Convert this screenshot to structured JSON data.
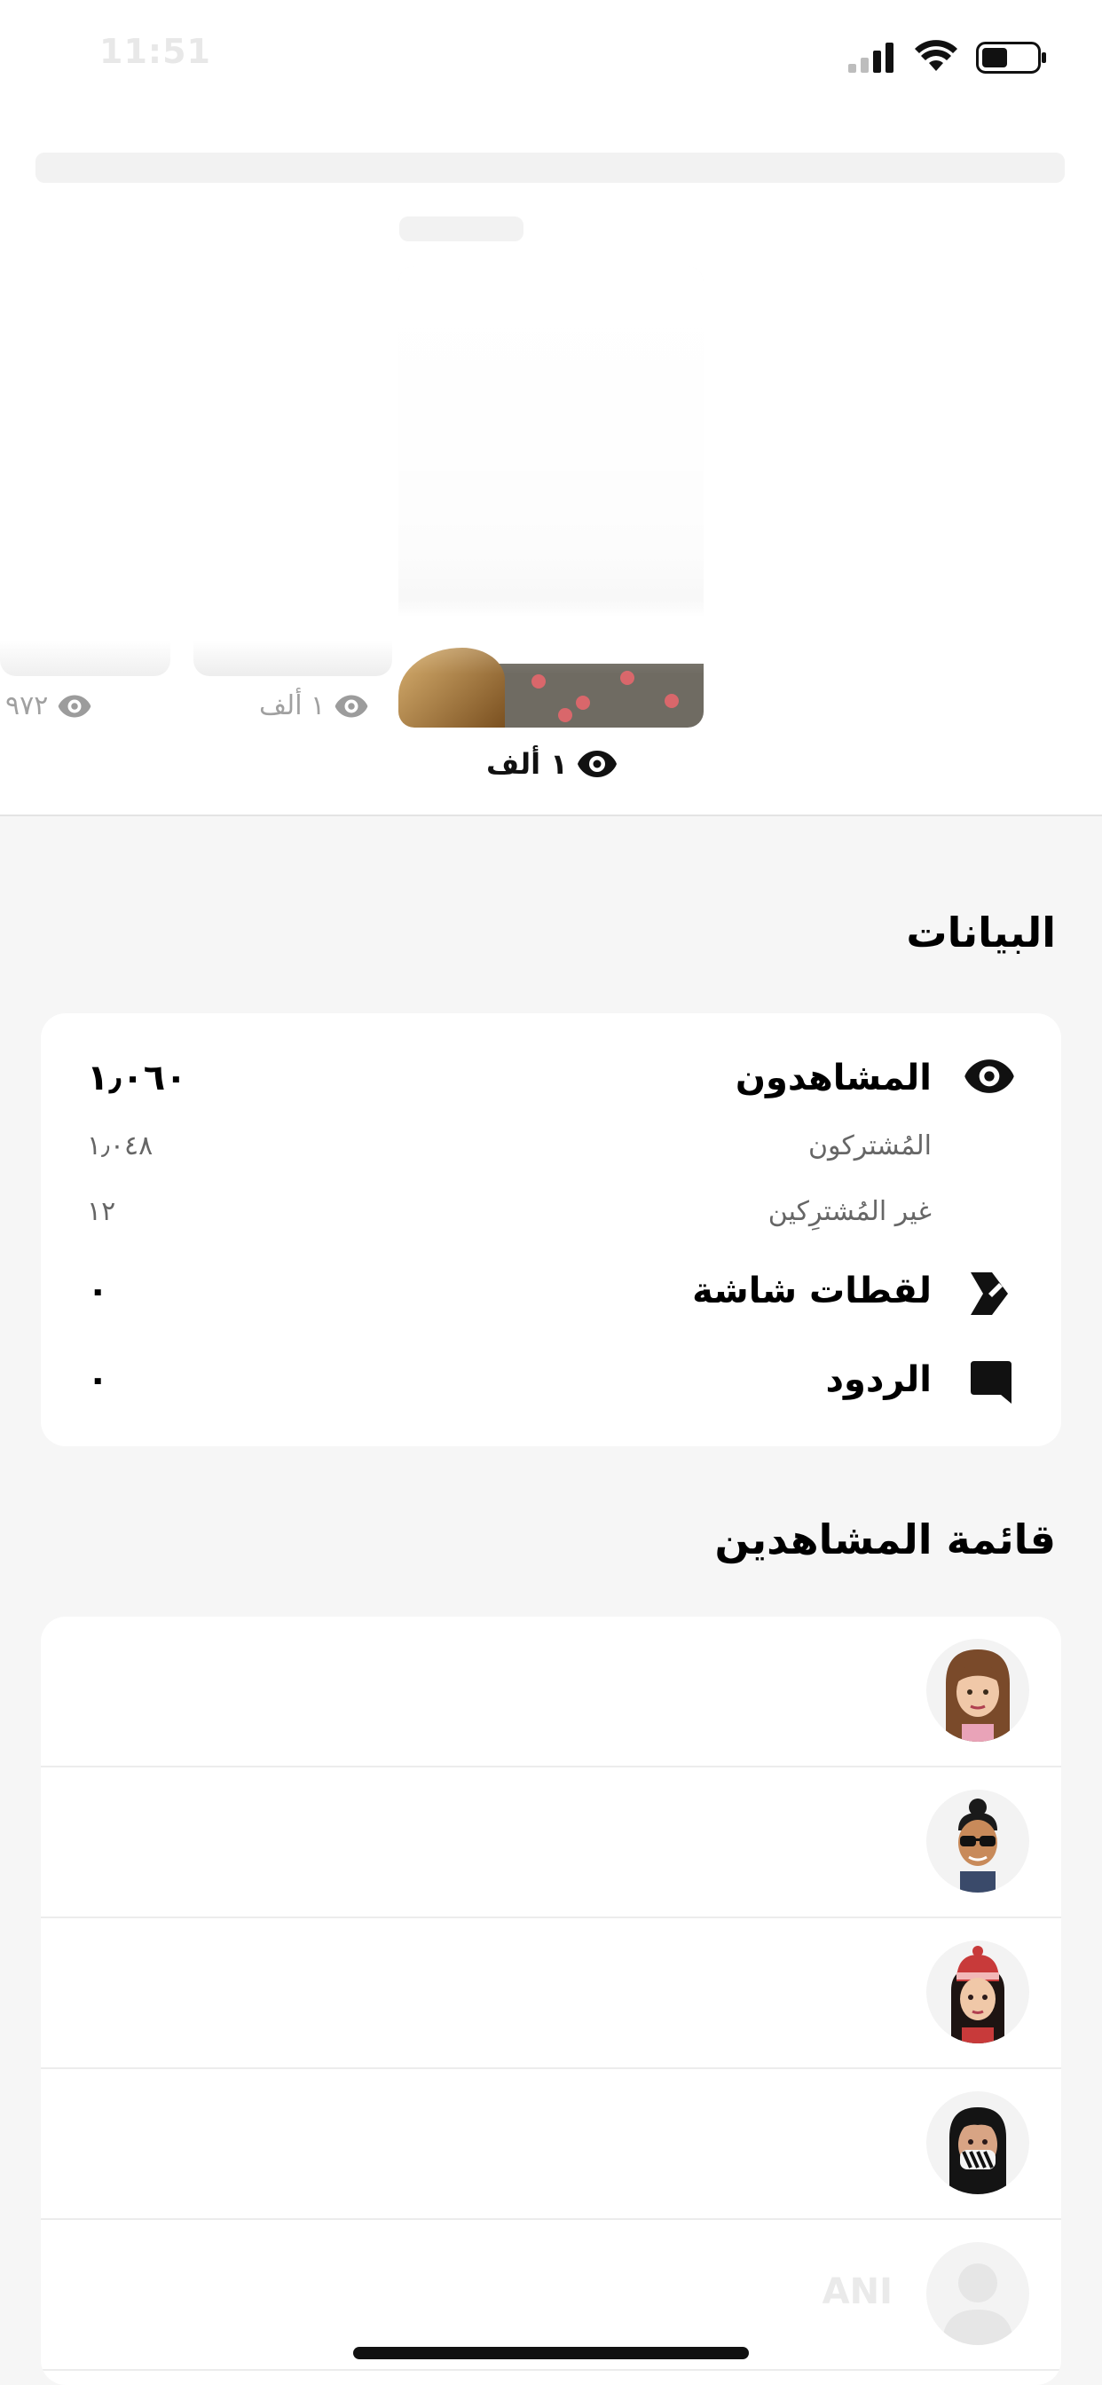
{
  "status_bar": {
    "time": "11:51"
  },
  "story": {
    "main_views": "١ ألف",
    "thumb2_views": "١ ألف",
    "thumb3_views": "٩٧٢"
  },
  "stats": {
    "title": "البيانات",
    "rows": [
      {
        "label": "المشاهدون",
        "value": "١٫٠٦٠",
        "icon": "eye-icon"
      },
      {
        "label": "المُشتركون",
        "value": "١٫٠٤٨"
      },
      {
        "label": "غير المُشترِكين",
        "value": "١٢"
      },
      {
        "label": "لقطات شاشة",
        "value": "٠",
        "icon": "screenshot-icon"
      },
      {
        "label": "الردود",
        "value": "٠",
        "icon": "chat-icon"
      }
    ]
  },
  "viewers": {
    "title": "قائمة المشاهدين",
    "items": [
      {
        "avatar": "bitmoji-brown-hair-avatar",
        "name": ""
      },
      {
        "avatar": "bitmoji-sunglasses-avatar",
        "name": ""
      },
      {
        "avatar": "bitmoji-beanie-avatar",
        "name": ""
      },
      {
        "avatar": "bitmoji-mask-avatar",
        "name": ""
      },
      {
        "avatar": "default-user-avatar",
        "name": "ANI"
      }
    ]
  },
  "colors": {
    "page_bg": "#f6f6f6",
    "card_bg": "#ffffff",
    "secondary_text": "#666666"
  }
}
